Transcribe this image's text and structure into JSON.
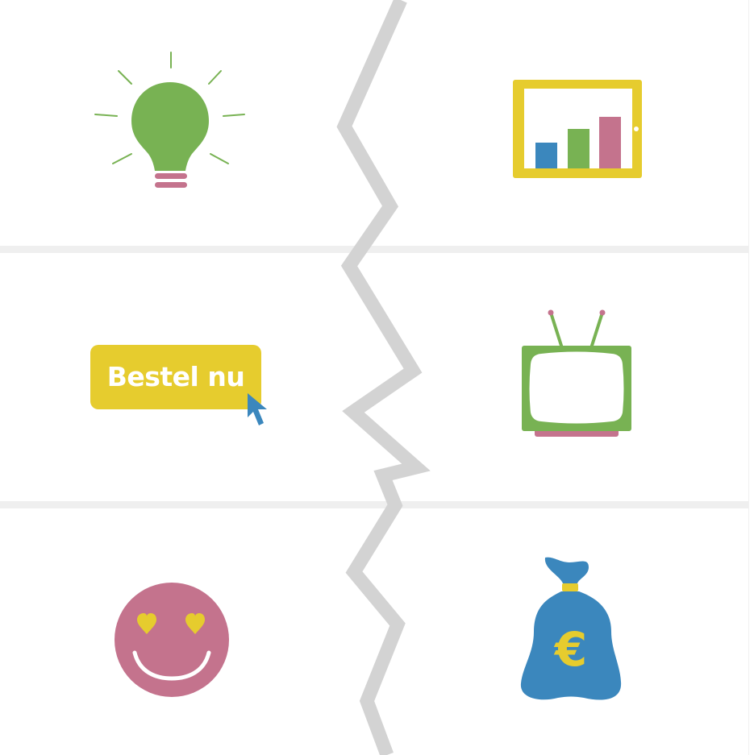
{
  "colors": {
    "green": "#78b253",
    "pink": "#c4738d",
    "yellow": "#e6cc2e",
    "blue": "#3b87bd",
    "divider": "#efefef",
    "zigzag": "#d3d3d3"
  },
  "icons": [
    {
      "name": "lightbulb-icon"
    },
    {
      "name": "bar-chart-tablet-icon"
    },
    {
      "name": "order-button-icon"
    },
    {
      "name": "television-icon"
    },
    {
      "name": "heart-eyes-smiley-icon"
    },
    {
      "name": "euro-money-bag-icon"
    }
  ],
  "order_button": {
    "label": "Bestel nu"
  },
  "money_bag": {
    "symbol": "€"
  }
}
